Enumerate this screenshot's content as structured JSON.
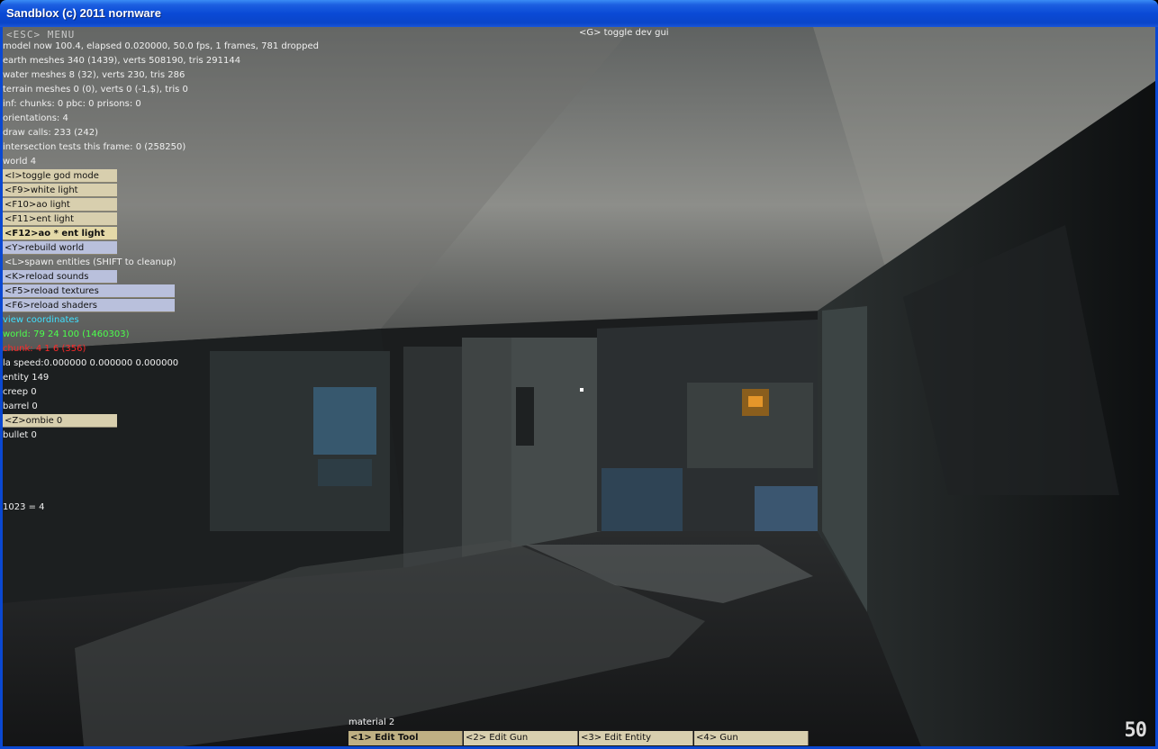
{
  "window": {
    "title": "Sandblox (c) 2011 nornware"
  },
  "hud": {
    "esc_menu": "<ESC> MENU",
    "dev_gui_hint": "<G> toggle dev gui",
    "stats": [
      "model now 100.4, elapsed 0.020000, 50.0 fps, 1 frames, 781 dropped",
      "earth meshes 340 (1439), verts 508190, tris 291144",
      "water meshes 8 (32), verts 230, tris 286",
      "terrain meshes 0 (0), verts 0 (-1,$), tris 0",
      "inf: chunks: 0 pbc: 0 prisons: 0",
      "orientations: 4",
      "draw calls: 233 (242)",
      "intersection tests this frame: 0 (258250)",
      "world 4"
    ],
    "buttons": [
      {
        "label": "<I>toggle god mode",
        "style": "tan"
      },
      {
        "label": "<F9>white light",
        "style": "tan"
      },
      {
        "label": "<F10>ao light",
        "style": "tan"
      },
      {
        "label": "<F11>ent light",
        "style": "tan"
      },
      {
        "label": "<F12>ao * ent light",
        "style": "tan-active"
      },
      {
        "label": "<Y>rebuild world",
        "style": "blue"
      },
      {
        "label": "<L>spawn entities (SHIFT to cleanup)",
        "style": "text"
      },
      {
        "label": "<K>reload sounds",
        "style": "blue"
      },
      {
        "label": "<F5>reload textures",
        "style": "blue-wide"
      },
      {
        "label": "<F6>reload shaders",
        "style": "blue-wide"
      }
    ],
    "view_coordinates": "view coordinates",
    "world_coords": "world: 79 24 100 (1460303)",
    "chunk_coords": "chunk: 4 1 6 (356)",
    "la_speed": "la speed:0.000000 0.000000 0.000000",
    "entity_counts": [
      "entity 149",
      "creep 0",
      "barrel 0"
    ],
    "zombie_button": "<Z>ombie 0",
    "bullet": "bullet 0",
    "equation": "1023 = 4",
    "material": "material 2",
    "tools": [
      {
        "label": "<1> Edit Tool",
        "active": true
      },
      {
        "label": "<2> Edit Gun",
        "active": false
      },
      {
        "label": "<3> Edit Entity",
        "active": false
      },
      {
        "label": "<4> Gun",
        "active": false
      }
    ],
    "fps_display": "50"
  },
  "colors": {
    "titlebar": "#0a4ad6",
    "button_tan": "#d8cfae",
    "button_blue": "#b9c0dc",
    "cyan_text": "#3fe0ff",
    "green_text": "#4cff4c",
    "red_text": "#ff2828"
  }
}
